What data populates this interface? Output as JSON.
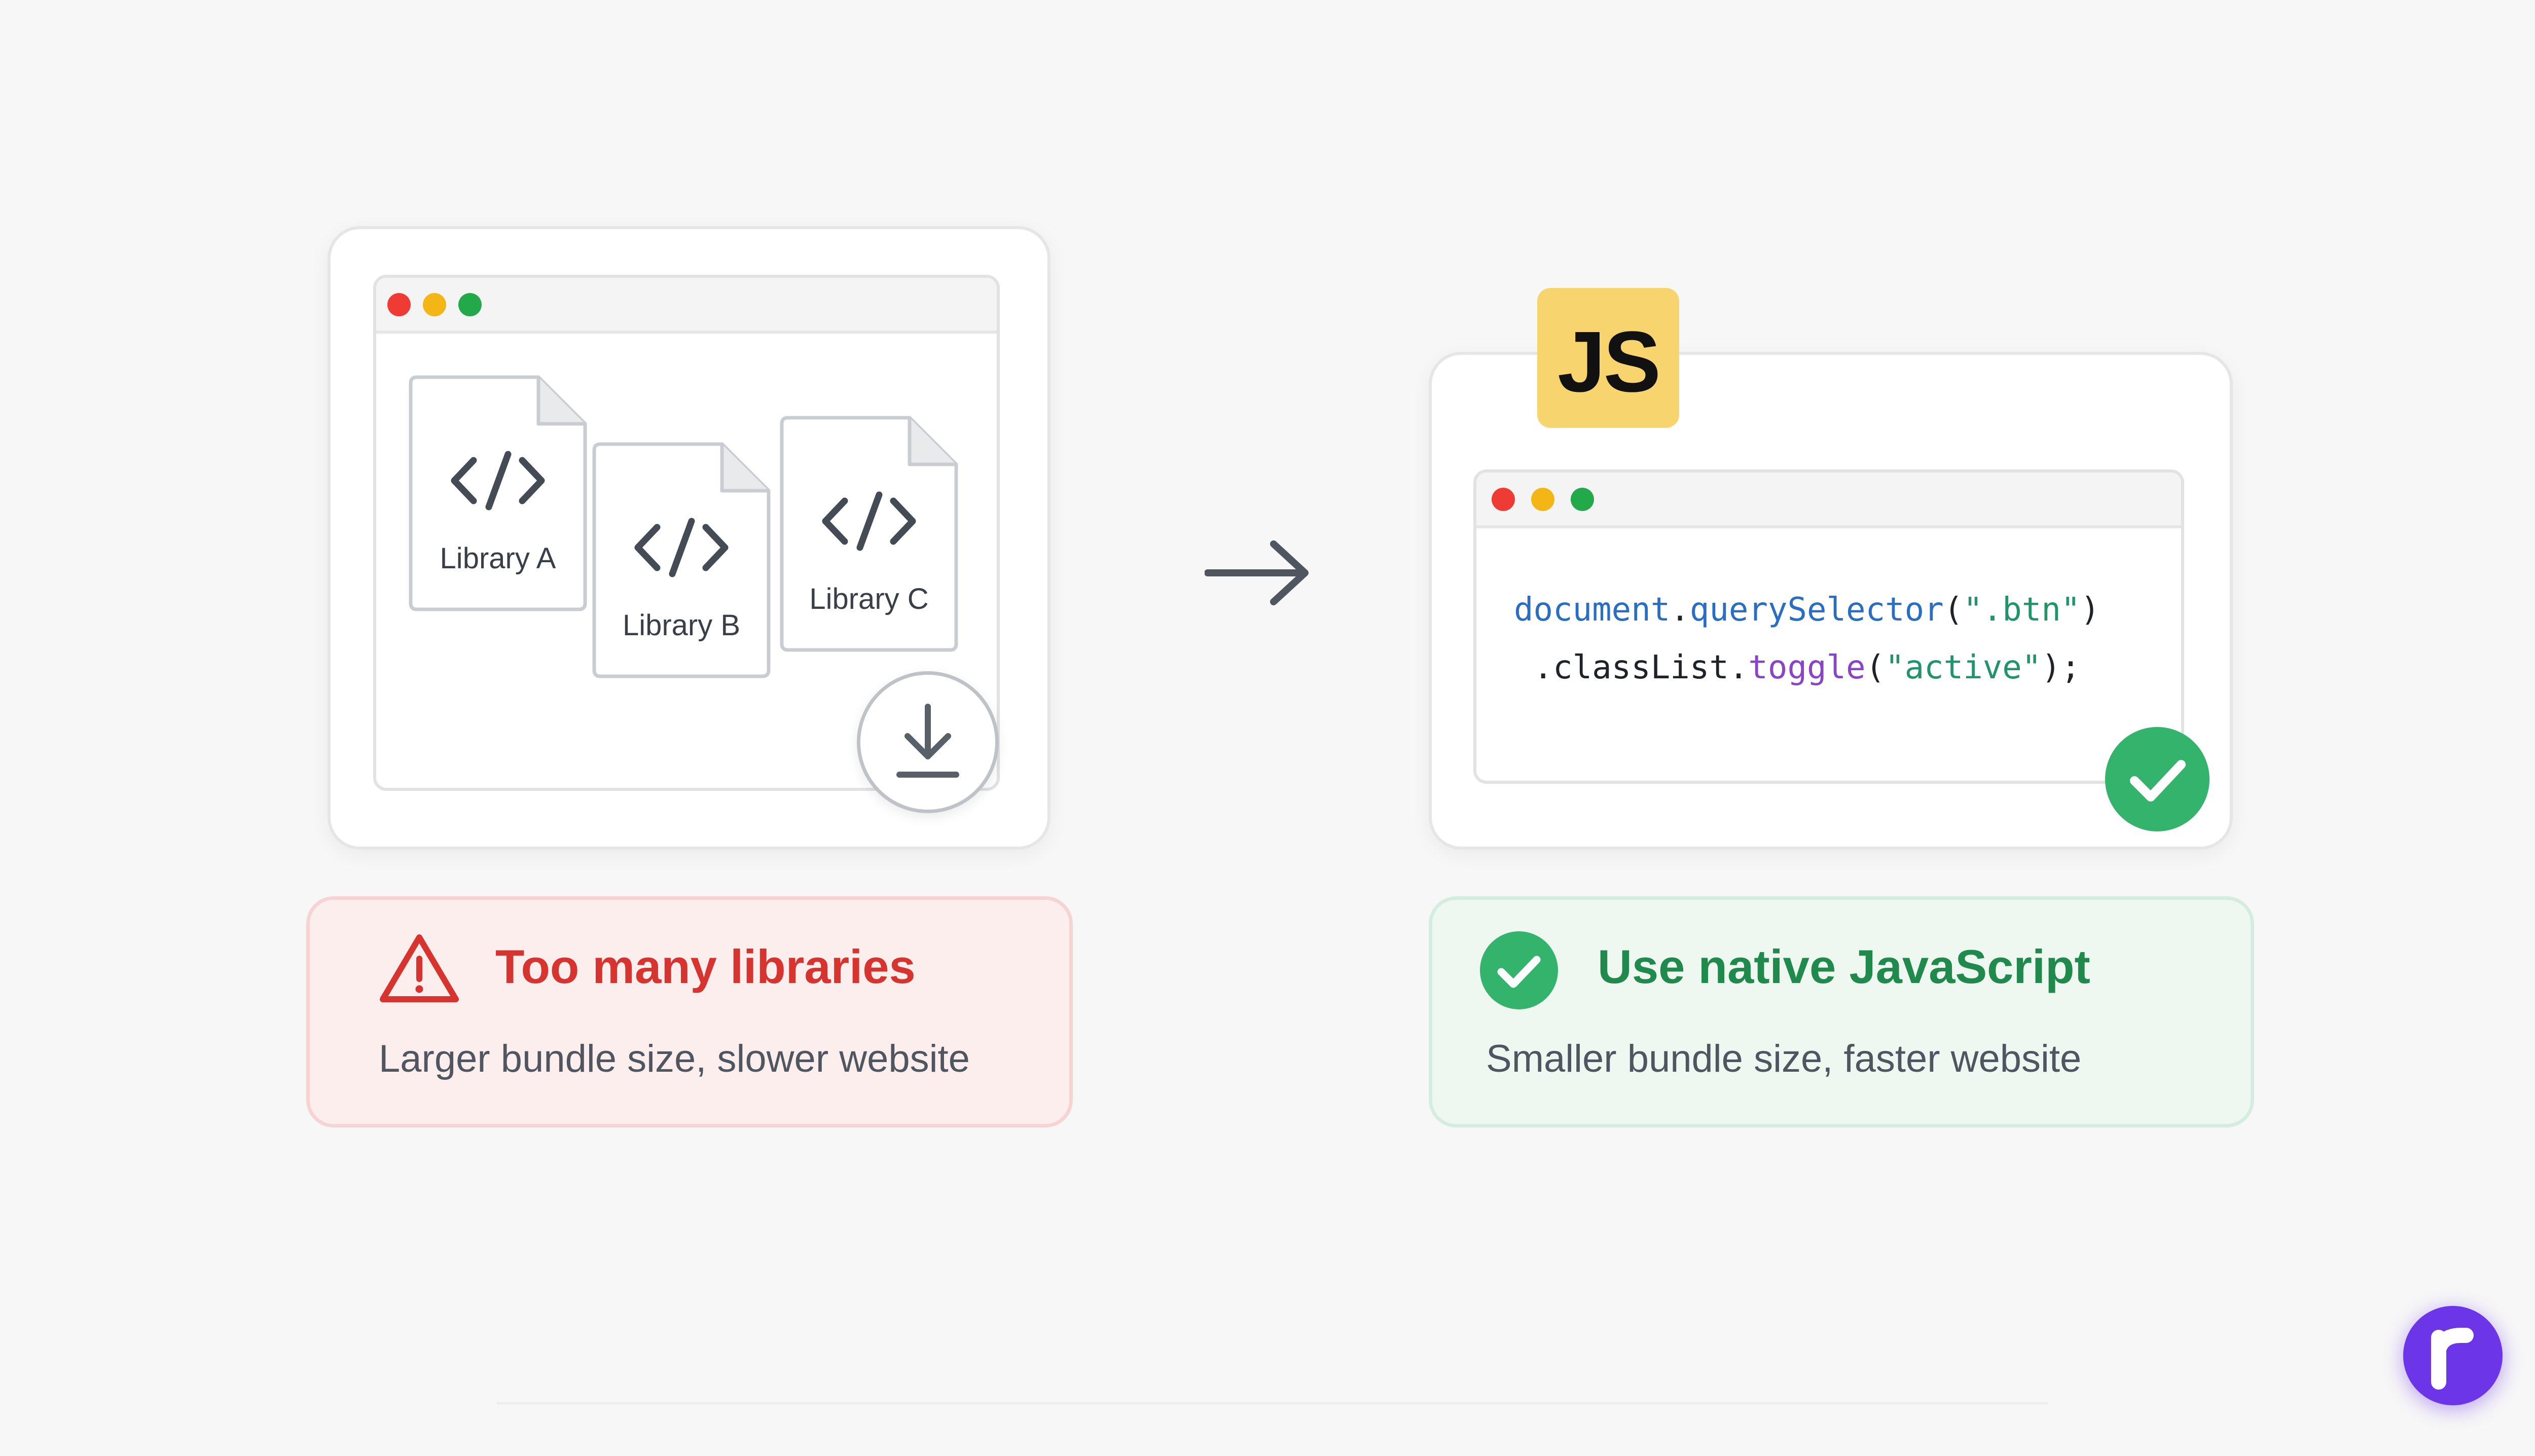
{
  "left_panel": {
    "files": [
      {
        "label": "Library A"
      },
      {
        "label": "Library B"
      },
      {
        "label": "Library C"
      }
    ],
    "status_title": "Too many libraries",
    "status_subtitle": "Larger bundle size, slower website",
    "status_icon": "warning-triangle-icon",
    "accent_color": "#d7332f"
  },
  "right_panel": {
    "badge": "JS",
    "code_lines": [
      [
        {
          "text": "document",
          "cls": "t-blue"
        },
        {
          "text": ".",
          "cls": ""
        },
        {
          "text": "querySelector",
          "cls": "t-blue"
        },
        {
          "text": "(",
          "cls": ""
        },
        {
          "text": "\".btn\"",
          "cls": "t-green"
        },
        {
          "text": ")",
          "cls": ""
        }
      ],
      [
        {
          "text": " .classList.",
          "cls": ""
        },
        {
          "text": "toggle",
          "cls": "t-purple"
        },
        {
          "text": "(",
          "cls": ""
        },
        {
          "text": "\"active\"",
          "cls": "t-green"
        },
        {
          "text": ");",
          "cls": ""
        }
      ]
    ],
    "status_title": "Use native JavaScript",
    "status_subtitle": "Smaller bundle size, faster website",
    "status_icon": "check-circle-icon",
    "accent_color": "#1f8a4c"
  },
  "connector_icon": "arrow-right-icon",
  "brand_icon": "brand-logo-icon",
  "colors": {
    "traffic_red": "#ee3b34",
    "traffic_yellow": "#f4b616",
    "traffic_green": "#22a94a",
    "js_yellow": "#f8d46e",
    "success_green": "#34b36c"
  }
}
